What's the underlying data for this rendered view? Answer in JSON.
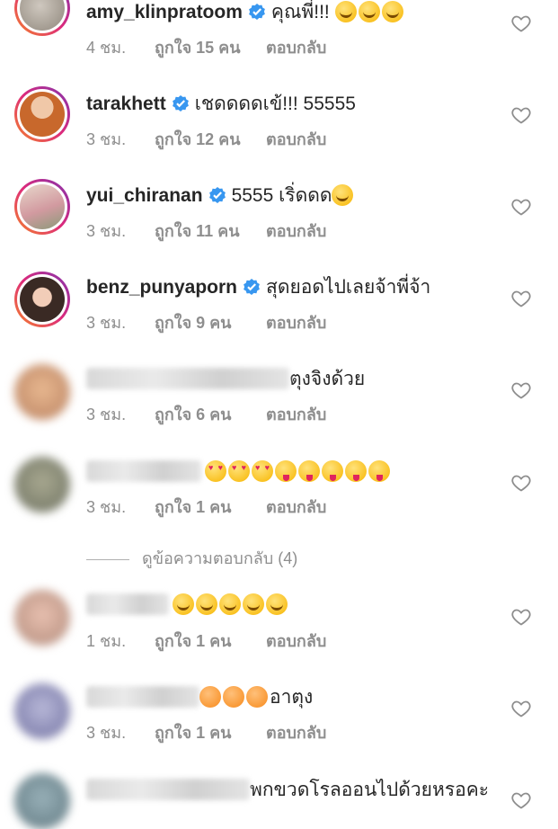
{
  "comments": [
    {
      "username": "amy_klinpratoom",
      "verified": true,
      "text": "คุณพี่!!! ",
      "emojis": [
        "grin",
        "grin",
        "grin"
      ],
      "time": "4 ชม.",
      "likes": "ถูกใจ 15 คน",
      "reply": "ตอบกลับ"
    },
    {
      "username": "tarakhett",
      "verified": true,
      "text": "เชดดดดเข้!!! 55555",
      "emojis": [],
      "time": "3 ชม.",
      "likes": "ถูกใจ 12 คน",
      "reply": "ตอบกลับ"
    },
    {
      "username": "yui_chiranan",
      "verified": true,
      "text": "5555 เริ่ดดด",
      "emojis": [
        "grin"
      ],
      "time": "3 ชม.",
      "likes": "ถูกใจ 11 คน",
      "reply": "ตอบกลับ"
    },
    {
      "username": "benz_punyaporn",
      "verified": true,
      "text": "สุดยอดไปเลยจ้าพี่จ้า",
      "emojis": [],
      "time": "3 ชม.",
      "likes": "ถูกใจ 9 คน",
      "reply": "ตอบกลับ"
    },
    {
      "username": "",
      "verified": false,
      "text": "ตุงจิงด้วย",
      "emojis": [],
      "time": "3 ชม.",
      "likes": "ถูกใจ 6 คน",
      "reply": "ตอบกลับ"
    },
    {
      "username": "",
      "verified": false,
      "text": "",
      "emojis": [
        "heart",
        "heart",
        "heart",
        "tongue",
        "tongue",
        "tongue",
        "tongue",
        "tongue"
      ],
      "time": "3 ชม.",
      "likes": "ถูกใจ 1 คน",
      "reply": "ตอบกลับ"
    },
    {
      "username": "",
      "verified": false,
      "text": "",
      "emojis": [
        "grin",
        "grin",
        "grin",
        "grin",
        "grin"
      ],
      "time": "1 ชม.",
      "likes": "ถูกใจ 1 คน",
      "reply": "ตอบกลับ"
    },
    {
      "username": "",
      "verified": false,
      "text": "อาตุง",
      "emojis": [
        "love",
        "love",
        "love"
      ],
      "time": "3 ชม.",
      "likes": "ถูกใจ 1 คน",
      "reply": "ตอบกลับ"
    },
    {
      "username": "",
      "verified": false,
      "text": "พกขวดโรลออนไปด้วยหรอคะ",
      "emojis": [],
      "time": "",
      "likes": "",
      "reply": ""
    }
  ],
  "view_replies": "ดูข้อความตอบกลับ (4)",
  "colors": {
    "verified": "#3897f0",
    "meta": "#8e8e8e",
    "text": "#262626"
  },
  "icons": {
    "like": "heart-outline-icon",
    "verified": "verified-badge-icon"
  }
}
